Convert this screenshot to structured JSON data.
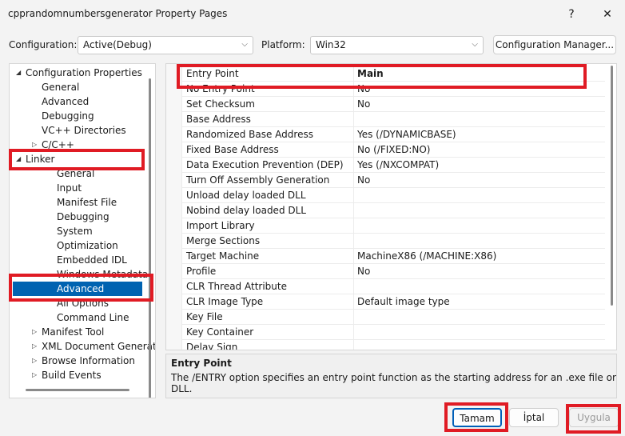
{
  "window": {
    "title": "cpprandomnumbersgenerator Property Pages",
    "help_glyph": "?",
    "close_glyph": "✕"
  },
  "toolbar": {
    "configuration_label": "Configuration:",
    "configuration_value": "Active(Debug)",
    "platform_label": "Platform:",
    "platform_value": "Win32",
    "config_manager_label": "Configuration Manager..."
  },
  "tree": {
    "items": [
      {
        "label": "Configuration Properties",
        "expander": "◢"
      },
      {
        "label": "General"
      },
      {
        "label": "Advanced"
      },
      {
        "label": "Debugging"
      },
      {
        "label": "VC++ Directories"
      },
      {
        "label": "C/C++",
        "expander": "▷"
      },
      {
        "label": "Linker",
        "expander": "◢"
      },
      {
        "label": "General"
      },
      {
        "label": "Input"
      },
      {
        "label": "Manifest File"
      },
      {
        "label": "Debugging"
      },
      {
        "label": "System"
      },
      {
        "label": "Optimization"
      },
      {
        "label": "Embedded IDL"
      },
      {
        "label": "Windows Metadata"
      },
      {
        "label": "Advanced",
        "selected": true
      },
      {
        "label": "All Options"
      },
      {
        "label": "Command Line"
      },
      {
        "label": "Manifest Tool",
        "expander": "▷"
      },
      {
        "label": "XML Document Generator",
        "expander": "▷"
      },
      {
        "label": "Browse Information",
        "expander": "▷"
      },
      {
        "label": "Build Events",
        "expander": "▷"
      }
    ]
  },
  "properties": [
    {
      "name": "Entry Point",
      "value": "Main",
      "bold": true
    },
    {
      "name": "No Entry Point",
      "value": "No"
    },
    {
      "name": "Set Checksum",
      "value": "No"
    },
    {
      "name": "Base Address",
      "value": ""
    },
    {
      "name": "Randomized Base Address",
      "value": "Yes (/DYNAMICBASE)"
    },
    {
      "name": "Fixed Base Address",
      "value": "No (/FIXED:NO)"
    },
    {
      "name": "Data Execution Prevention (DEP)",
      "value": "Yes (/NXCOMPAT)"
    },
    {
      "name": "Turn Off Assembly Generation",
      "value": "No"
    },
    {
      "name": "Unload delay loaded DLL",
      "value": ""
    },
    {
      "name": "Nobind delay loaded DLL",
      "value": ""
    },
    {
      "name": "Import Library",
      "value": ""
    },
    {
      "name": "Merge Sections",
      "value": ""
    },
    {
      "name": "Target Machine",
      "value": "MachineX86 (/MACHINE:X86)"
    },
    {
      "name": "Profile",
      "value": "No"
    },
    {
      "name": "CLR Thread Attribute",
      "value": ""
    },
    {
      "name": "CLR Image Type",
      "value": "Default image type"
    },
    {
      "name": "Key File",
      "value": ""
    },
    {
      "name": "Key Container",
      "value": ""
    },
    {
      "name": "Delay Sign",
      "value": ""
    }
  ],
  "description": {
    "title": "Entry Point",
    "text": "The /ENTRY option specifies an entry point function as the starting address for an .exe file or DLL."
  },
  "footer": {
    "ok_label": "Tamam",
    "cancel_label": "İptal",
    "apply_label": "Uygula"
  },
  "colors": {
    "highlight": "#e01b24",
    "selection": "#0063b1"
  }
}
